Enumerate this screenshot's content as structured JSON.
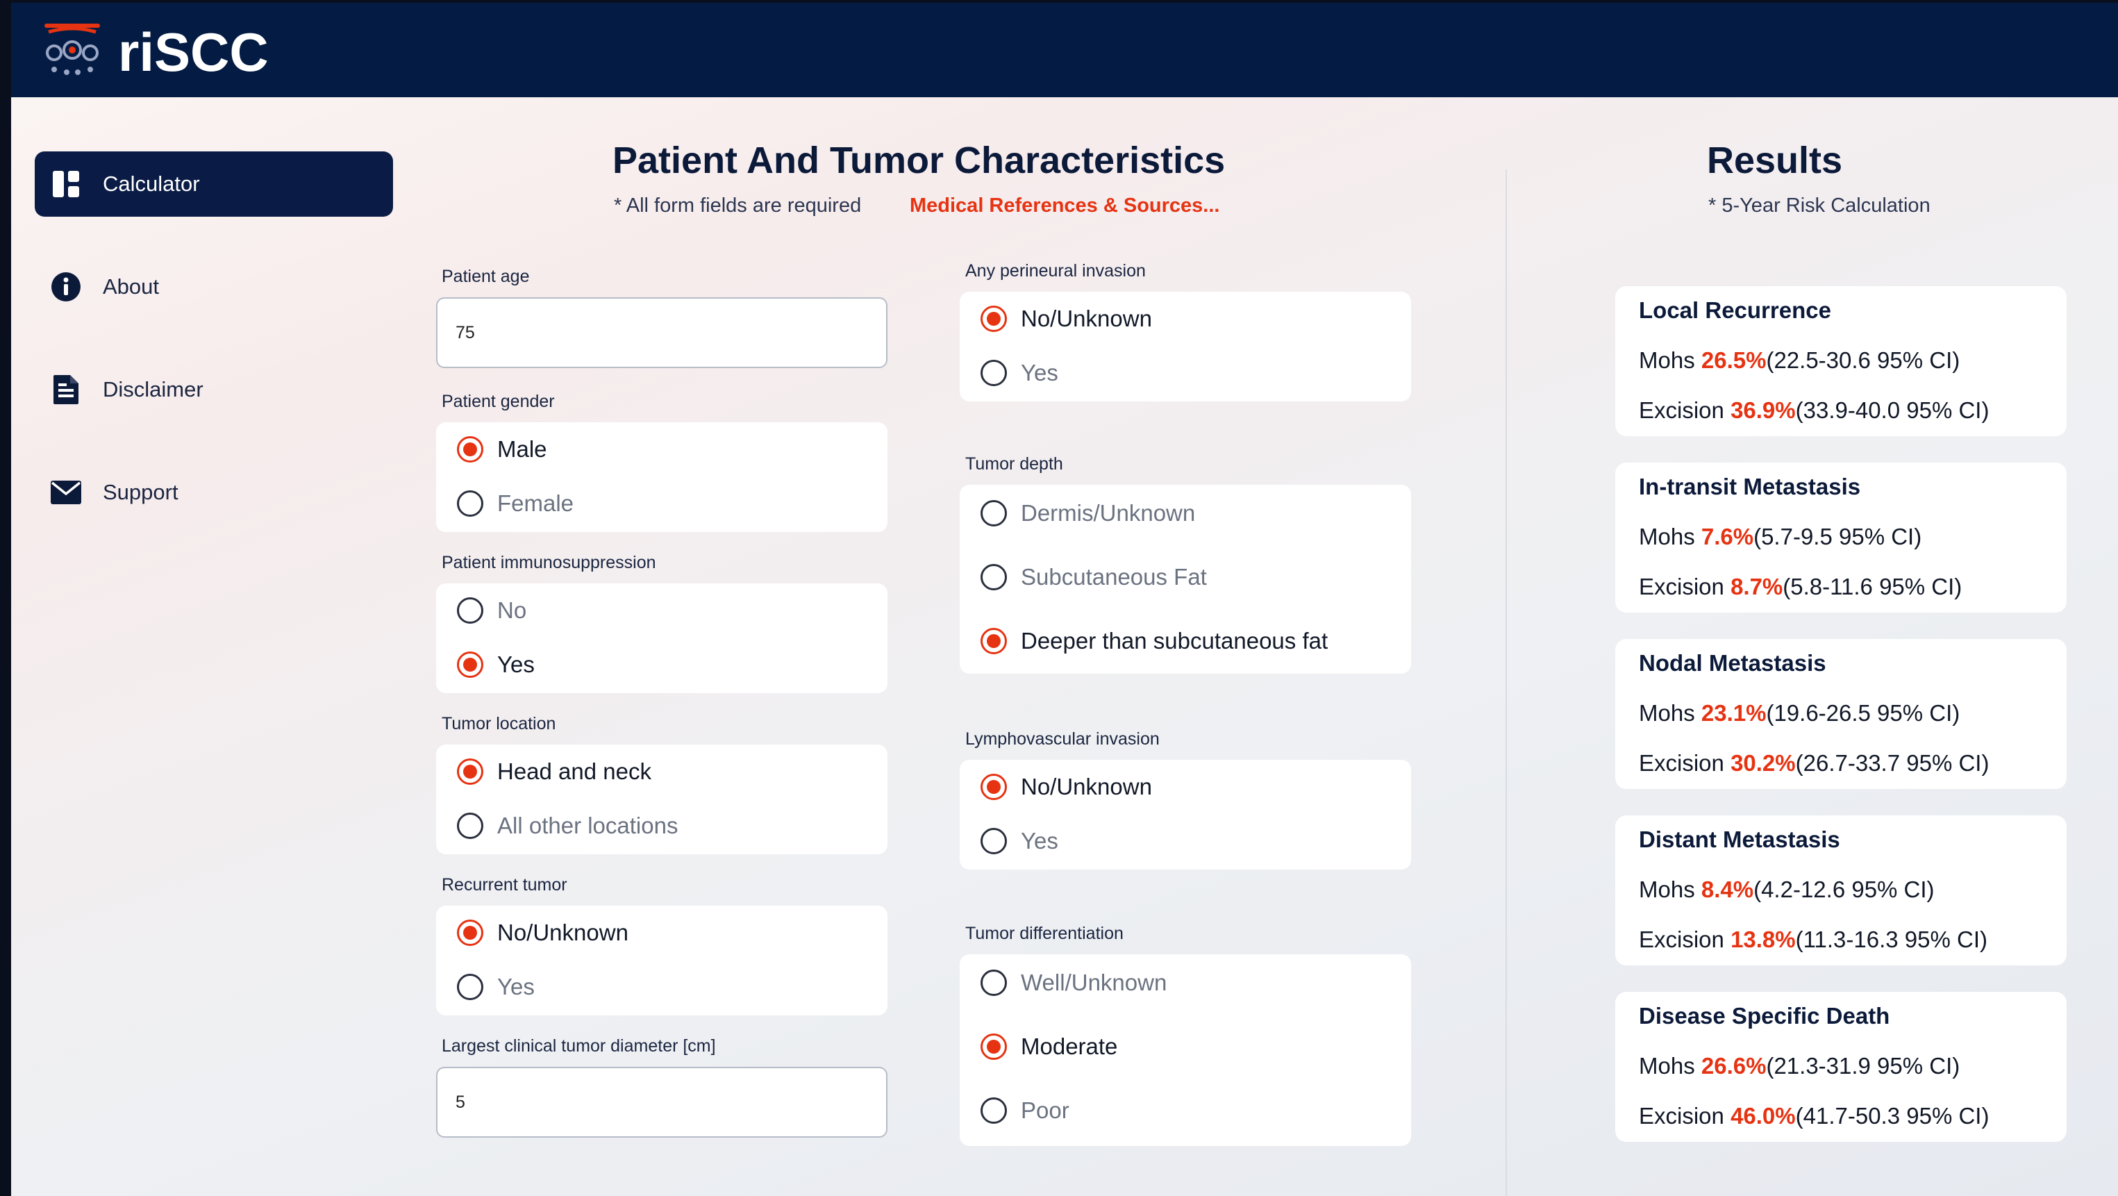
{
  "app": {
    "brand": "riSCC"
  },
  "sidebar": {
    "items": [
      {
        "label": "Calculator",
        "icon": "dashboard-icon",
        "active": true
      },
      {
        "label": "About",
        "icon": "info-icon"
      },
      {
        "label": "Disclaimer",
        "icon": "document-icon"
      },
      {
        "label": "Support",
        "icon": "mail-icon"
      }
    ]
  },
  "form": {
    "title": "Patient And Tumor Characteristics",
    "required_note": "* All form fields are required",
    "references_link": "Medical References & Sources...",
    "patient_age": {
      "label": "Patient age",
      "value": "75"
    },
    "patient_gender": {
      "label": "Patient gender",
      "options": [
        "Male",
        "Female"
      ],
      "selected": "Male"
    },
    "immunosuppression": {
      "label": "Patient immunosuppression",
      "options": [
        "No",
        "Yes"
      ],
      "selected": "Yes"
    },
    "tumor_location": {
      "label": "Tumor location",
      "options": [
        "Head and neck",
        "All other locations"
      ],
      "selected": "Head and neck"
    },
    "recurrent_tumor": {
      "label": "Recurrent tumor",
      "options": [
        "No/Unknown",
        "Yes"
      ],
      "selected": "No/Unknown"
    },
    "tumor_diameter": {
      "label": "Largest clinical tumor diameter [cm]",
      "value": "5"
    },
    "perineural_invasion": {
      "label": "Any perineural invasion",
      "options": [
        "No/Unknown",
        "Yes"
      ],
      "selected": "No/Unknown"
    },
    "tumor_depth": {
      "label": "Tumor depth",
      "options": [
        "Dermis/Unknown",
        "Subcutaneous Fat",
        "Deeper than subcutaneous fat"
      ],
      "selected": "Deeper than subcutaneous fat"
    },
    "lymphovascular_invasion": {
      "label": "Lymphovascular invasion",
      "options": [
        "No/Unknown",
        "Yes"
      ],
      "selected": "No/Unknown"
    },
    "tumor_differentiation": {
      "label": "Tumor differentiation",
      "options": [
        "Well/Unknown",
        "Moderate",
        "Poor"
      ],
      "selected": "Moderate"
    }
  },
  "results": {
    "title": "Results",
    "subtitle": "* 5-Year Risk Calculation",
    "cards": [
      {
        "title": "Local Recurrence",
        "mohs": {
          "label": "Mohs",
          "pct": "26.5%",
          "ci": "(22.5-30.6 95% CI)"
        },
        "excision": {
          "label": "Excision",
          "pct": "36.9%",
          "ci": "(33.9-40.0 95% CI)"
        }
      },
      {
        "title": "In-transit Metastasis",
        "mohs": {
          "label": "Mohs",
          "pct": "7.6%",
          "ci": "(5.7-9.5 95% CI)"
        },
        "excision": {
          "label": "Excision",
          "pct": "8.7%",
          "ci": "(5.8-11.6 95% CI)"
        }
      },
      {
        "title": "Nodal Metastasis",
        "mohs": {
          "label": "Mohs",
          "pct": "23.1%",
          "ci": "(19.6-26.5 95% CI)"
        },
        "excision": {
          "label": "Excision",
          "pct": "30.2%",
          "ci": "(26.7-33.7 95% CI)"
        }
      },
      {
        "title": "Distant Metastasis",
        "mohs": {
          "label": "Mohs",
          "pct": "8.4%",
          "ci": "(4.2-12.6 95% CI)"
        },
        "excision": {
          "label": "Excision",
          "pct": "13.8%",
          "ci": "(11.3-16.3 95% CI)"
        }
      },
      {
        "title": "Disease Specific Death",
        "mohs": {
          "label": "Mohs",
          "pct": "26.6%",
          "ci": "(21.3-31.9 95% CI)"
        },
        "excision": {
          "label": "Excision",
          "pct": "46.0%",
          "ci": "(41.7-50.3 95% CI)"
        }
      }
    ]
  },
  "colors": {
    "navy": "#041c44",
    "accent": "#e63312"
  }
}
